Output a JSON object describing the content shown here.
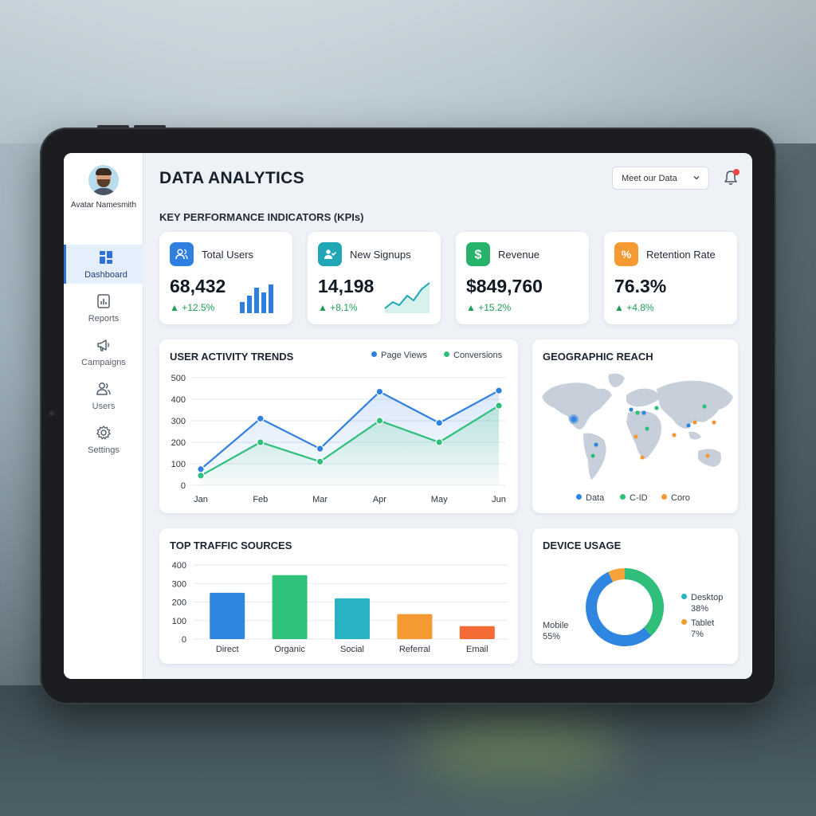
{
  "user": {
    "name": "Avatar Namesmith"
  },
  "nav": [
    {
      "label": "Dashboard",
      "icon": "dashboard-icon",
      "active": true
    },
    {
      "label": "Reports",
      "icon": "reports-icon",
      "active": false
    },
    {
      "label": "Campaigns",
      "icon": "megaphone-icon",
      "active": false
    },
    {
      "label": "Users",
      "icon": "users-icon",
      "active": false
    },
    {
      "label": "Settings",
      "icon": "gear-icon",
      "active": false
    }
  ],
  "header": {
    "title": "DATA ANALYTICS",
    "dropdown_value": "Meet our Data"
  },
  "kpi_section_title": "KEY PERFORMANCE INDICATORS (KPIs)",
  "kpis": [
    {
      "name": "Total Users",
      "value": "68,432",
      "change": "▲ +12.5%",
      "icon": "users-icon",
      "color": "#2f7fe0"
    },
    {
      "name": "New Signups",
      "value": "14,198",
      "change": "▲ +8.1%",
      "icon": "user-check-icon",
      "color": "#21a6b5"
    },
    {
      "name": "Revenue",
      "value": "$849,760",
      "change": "▲ +15.2%",
      "icon": "dollar-icon",
      "color": "#27b36a"
    },
    {
      "name": "Retention Rate",
      "value": "76.3%",
      "change": "▲ +4.8%",
      "icon": "percent-icon",
      "color": "#f59a33"
    }
  ],
  "colors": {
    "blue": "#2f7fe0",
    "green": "#2fbf7a",
    "teal": "#22b3c4",
    "orange": "#f59a33",
    "red_orange": "#f46b35"
  },
  "activity": {
    "title": "USER ACTIVITY TRENDS"
  },
  "geo": {
    "title": "GEOGRAPHIC REACH",
    "legend": [
      "Data",
      "C-ID",
      "Coro"
    ]
  },
  "traffic": {
    "title": "TOP TRAFFIC SOURCES"
  },
  "device": {
    "title": "DEVICE USAGE",
    "mobile_label": "Mobile",
    "mobile_pct": "55%",
    "desktop_label": "Desktop",
    "desktop_pct": "38%",
    "tablet_label": "Tablet",
    "tablet_pct": "7%"
  },
  "chart_data": [
    {
      "type": "line",
      "title": "USER ACTIVITY TRENDS",
      "x": [
        "Jan",
        "Feb",
        "Mar",
        "Apr",
        "May",
        "Jun"
      ],
      "ylim": [
        0,
        500
      ],
      "yticks": [
        0,
        100,
        200,
        300,
        400,
        500
      ],
      "grid": true,
      "legend": "top-right",
      "series": [
        {
          "name": "Page Views",
          "color": "#2f7fe0",
          "values": [
            75,
            310,
            170,
            435,
            290,
            440
          ]
        },
        {
          "name": "Conversions",
          "color": "#2fbf7a",
          "values": [
            45,
            200,
            110,
            300,
            200,
            370
          ]
        }
      ]
    },
    {
      "type": "bar",
      "title": "TOP TRAFFIC SOURCES",
      "categories": [
        "Direct",
        "Organic",
        "Social",
        "Referral",
        "Email"
      ],
      "values": [
        250,
        345,
        220,
        135,
        70
      ],
      "colors": [
        "#2f86e0",
        "#2fc27a",
        "#27b3c4",
        "#f59a33",
        "#f46b35"
      ],
      "ylim": [
        0,
        400
      ],
      "yticks": [
        0,
        100,
        200,
        300,
        400
      ],
      "grid": true
    },
    {
      "type": "pie",
      "title": "DEVICE USAGE",
      "categories": [
        "Mobile",
        "Desktop",
        "Tablet"
      ],
      "values": [
        55,
        38,
        7
      ],
      "colors": [
        "#2f86e0",
        "#2fbf7a",
        "#f5a23a"
      ]
    }
  ]
}
